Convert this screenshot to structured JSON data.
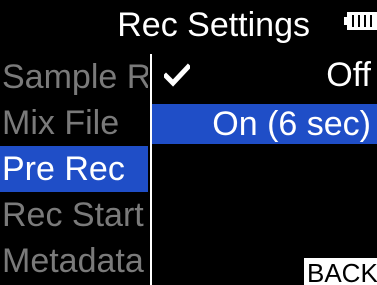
{
  "header": {
    "title": "Rec Settings",
    "battery_icon": "battery-icon"
  },
  "menu": {
    "items": [
      {
        "label": "Sample Rate",
        "selected": false
      },
      {
        "label": "Mix File",
        "selected": false
      },
      {
        "label": "Pre Rec",
        "selected": true
      },
      {
        "label": "Rec Start",
        "selected": false
      },
      {
        "label": "Metadata",
        "selected": false
      }
    ]
  },
  "options": {
    "off": {
      "label": "Off",
      "checked": true,
      "highlighted": false
    },
    "on": {
      "label": "On (6 sec)",
      "checked": false,
      "highlighted": true
    },
    "check_icon": "check-icon"
  },
  "footer": {
    "back_label": "BACK"
  },
  "colors": {
    "background": "#000000",
    "highlight": "#1f4ec7",
    "text": "#ffffff",
    "inactive_text": "#7a7a7a"
  }
}
